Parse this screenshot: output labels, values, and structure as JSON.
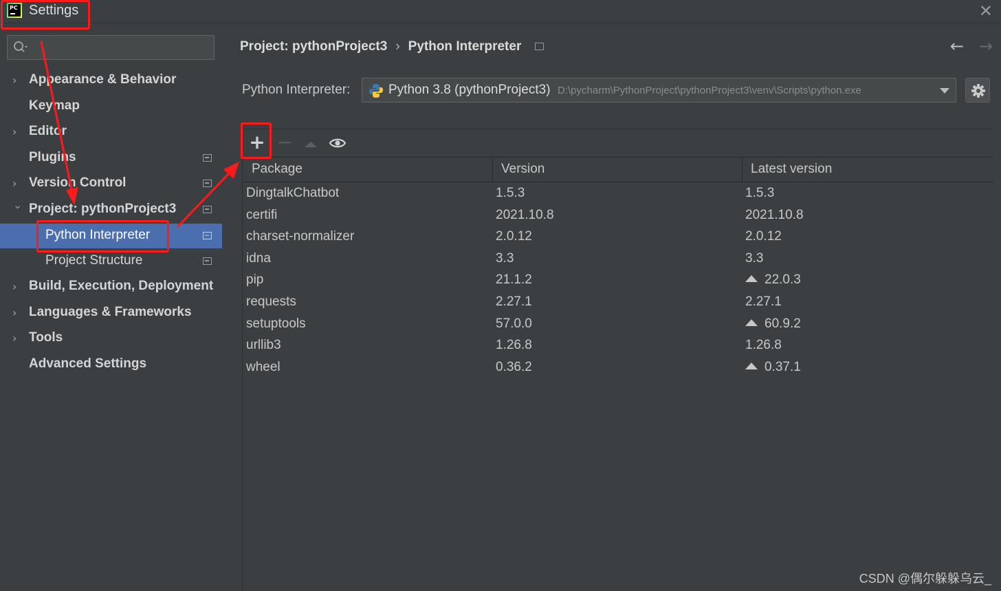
{
  "window": {
    "title": "Settings"
  },
  "search": {
    "placeholder": ""
  },
  "sidebar": {
    "items": [
      {
        "label": "Appearance & Behavior"
      },
      {
        "label": "Keymap"
      },
      {
        "label": "Editor"
      },
      {
        "label": "Plugins"
      },
      {
        "label": "Version Control"
      },
      {
        "label": "Project: pythonProject3"
      },
      {
        "label": "Python Interpreter"
      },
      {
        "label": "Project Structure"
      },
      {
        "label": "Build, Execution, Deployment"
      },
      {
        "label": "Languages & Frameworks"
      },
      {
        "label": "Tools"
      },
      {
        "label": "Advanced Settings"
      }
    ]
  },
  "breadcrumb": {
    "project": "Project: pythonProject3",
    "separator": "›",
    "page": "Python Interpreter"
  },
  "interpreter": {
    "label": "Python Interpreter:",
    "name": "Python 3.8 (pythonProject3)",
    "path": "D:\\pycharm\\PythonProject\\pythonProject3\\venv\\Scripts\\python.exe"
  },
  "toolbar": {
    "add": "+",
    "remove": "−"
  },
  "table": {
    "headers": [
      "Package",
      "Version",
      "Latest version"
    ],
    "rows": [
      {
        "package": "DingtalkChatbot",
        "version": "1.5.3",
        "latest": "1.5.3",
        "upgrade": false
      },
      {
        "package": "certifi",
        "version": "2021.10.8",
        "latest": "2021.10.8",
        "upgrade": false
      },
      {
        "package": "charset-normalizer",
        "version": "2.0.12",
        "latest": "2.0.12",
        "upgrade": false
      },
      {
        "package": "idna",
        "version": "3.3",
        "latest": "3.3",
        "upgrade": false
      },
      {
        "package": "pip",
        "version": "21.1.2",
        "latest": "22.0.3",
        "upgrade": true
      },
      {
        "package": "requests",
        "version": "2.27.1",
        "latest": "2.27.1",
        "upgrade": false
      },
      {
        "package": "setuptools",
        "version": "57.0.0",
        "latest": "60.9.2",
        "upgrade": true
      },
      {
        "package": "urllib3",
        "version": "1.26.8",
        "latest": "1.26.8",
        "upgrade": false
      },
      {
        "package": "wheel",
        "version": "0.36.2",
        "latest": "0.37.1",
        "upgrade": true
      }
    ]
  },
  "watermark": "CSDN @偶尔躲躲乌云_",
  "colors": {
    "selection": "#4b6eaf",
    "annotation": "#ff1a1a",
    "background": "#3c3f41"
  }
}
